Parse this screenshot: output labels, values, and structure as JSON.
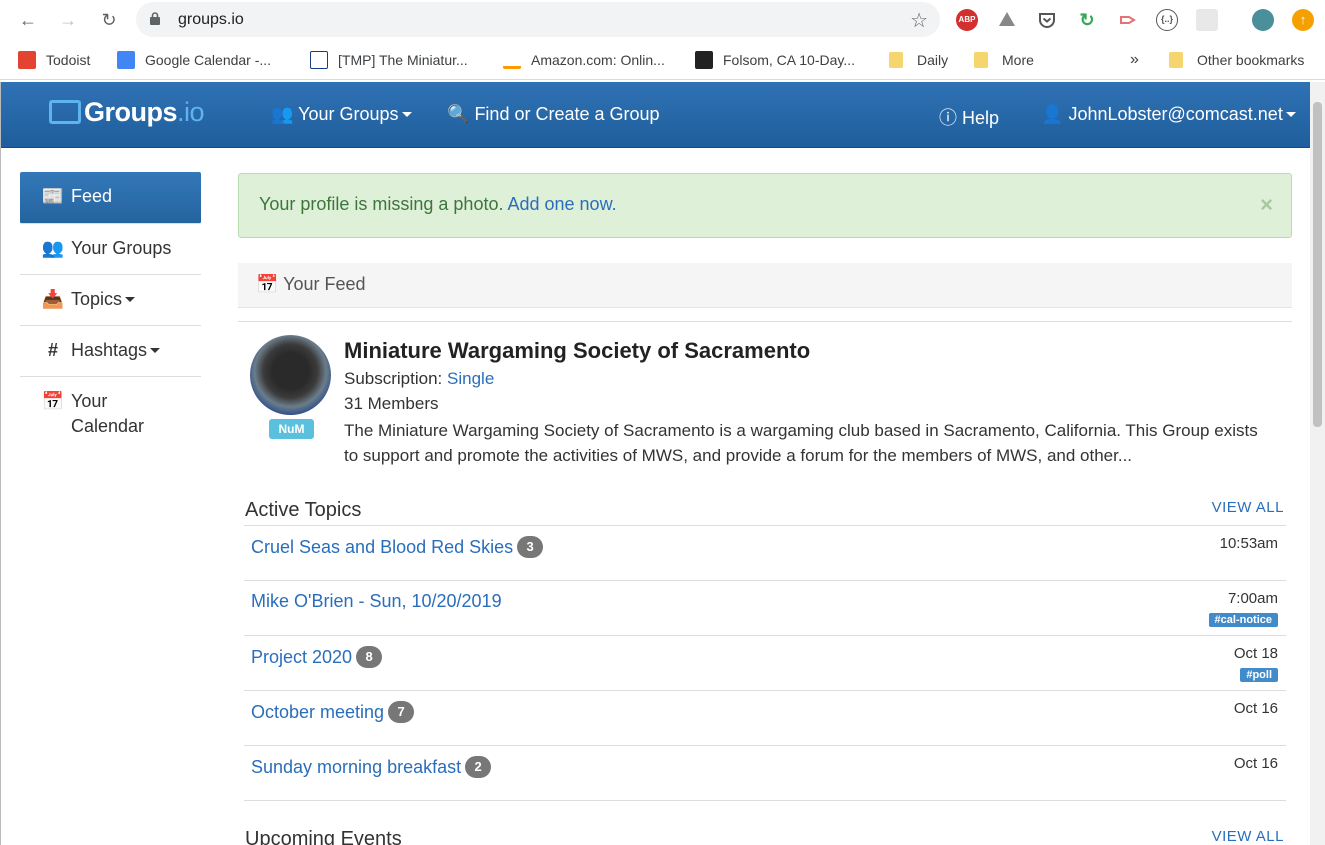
{
  "browser": {
    "url": "groups.io",
    "bookmarks": [
      "Todoist",
      "Google Calendar -...",
      "[TMP] The Miniatur...",
      "Amazon.com: Onlin...",
      "Folsom, CA 10-Day...",
      "Daily",
      "More"
    ],
    "overflow": "»",
    "other_bookmarks": "Other bookmarks",
    "extensions": [
      "ABP"
    ]
  },
  "navbar": {
    "brand": "Groups",
    "brand_suffix": ".io",
    "your_groups": "Your Groups",
    "find_create": "Find or Create a Group",
    "help": "Help",
    "account": "JohnLobster@comcast.net"
  },
  "sidebar": {
    "items": [
      {
        "label": "Feed",
        "icon": "newspaper-icon"
      },
      {
        "label": "Your Groups",
        "icon": "users-icon"
      },
      {
        "label": "Topics",
        "icon": "inbox-icon"
      },
      {
        "label": "Hashtags",
        "icon": "hashtag-icon"
      },
      {
        "label": "Your Calendar",
        "icon": "calendar-icon"
      }
    ]
  },
  "alert": {
    "text": "Your profile is missing a photo.",
    "link": "Add one now.",
    "close": "×"
  },
  "feed": {
    "heading": "Your Feed"
  },
  "group": {
    "name": "Miniature Wargaming Society of Sacramento",
    "subscription_label": "Subscription:",
    "subscription_value": "Single",
    "members": "31 Members",
    "badge": "NuM",
    "description": "The Miniature Wargaming Society of Sacramento is a wargaming club based in Sacramento, California. This Group exists to support and promote the activities of MWS, and provide a forum for the members of MWS, and other..."
  },
  "active_topics": {
    "title": "Active Topics",
    "view_all": "VIEW ALL",
    "items": [
      {
        "title": "Cruel Seas and Blood Red Skies",
        "count": "3",
        "time": "10:53am",
        "tag": ""
      },
      {
        "title": "Mike O'Brien - Sun, 10/20/2019",
        "count": "",
        "time": "7:00am",
        "tag": "#cal-notice"
      },
      {
        "title": "Project 2020",
        "count": "8",
        "time": "Oct 18",
        "tag": "#poll"
      },
      {
        "title": "October meeting",
        "count": "7",
        "time": "Oct 16",
        "tag": ""
      },
      {
        "title": "Sunday morning breakfast",
        "count": "2",
        "time": "Oct 16",
        "tag": ""
      }
    ]
  },
  "upcoming_events": {
    "title": "Upcoming Events",
    "view_all": "VIEW ALL"
  }
}
